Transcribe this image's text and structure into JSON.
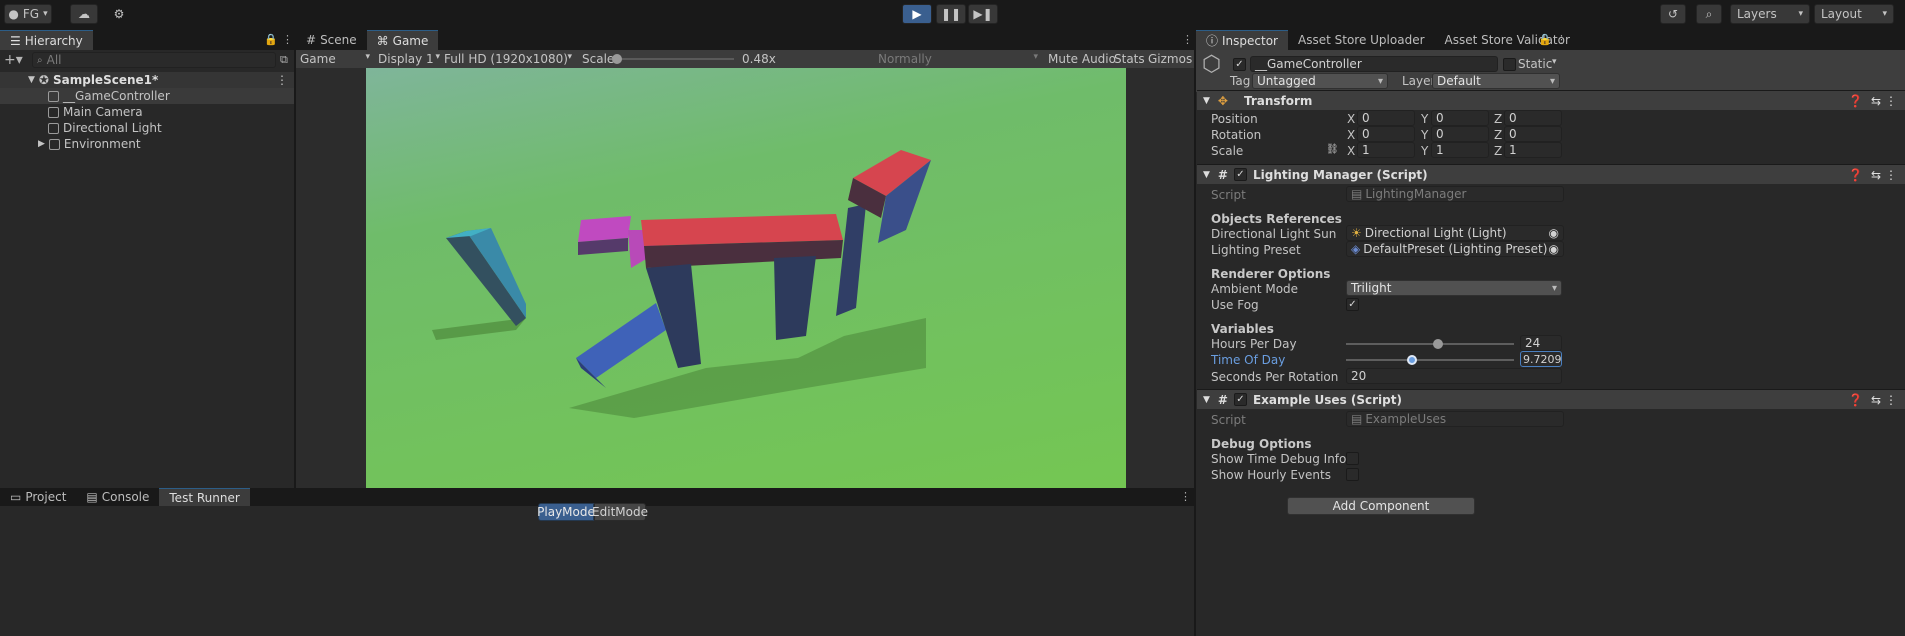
{
  "toolbar": {
    "account": "FG",
    "layers": "Layers",
    "layout": "Layout"
  },
  "hierarchy": {
    "tab": "Hierarchy",
    "search_placeholder": "All",
    "scene": "SampleScene1*",
    "items": [
      "__GameController",
      "Main Camera",
      "Directional Light",
      "Environment"
    ]
  },
  "center": {
    "tabs": [
      "Scene",
      "Game"
    ],
    "display_mode": "Game",
    "display": "Display 1",
    "resolution": "Full HD (1920x1080)",
    "scale_label": "Scale",
    "scale_value": "0.48x",
    "play_focus": "Normally",
    "mute": "Mute Audio",
    "stats": "Stats",
    "gizmos": "Gizmos"
  },
  "bottom": {
    "tabs": [
      "Project",
      "Console",
      "Test Runner"
    ],
    "modes": [
      "PlayMode",
      "EditMode"
    ]
  },
  "inspector": {
    "tabs": [
      "Inspector",
      "Asset Store Uploader",
      "Asset Store Validator"
    ],
    "object_name": "__GameController",
    "static_label": "Static",
    "tag_label": "Tag",
    "tag_value": "Untagged",
    "layer_label": "Layer",
    "layer_value": "Default",
    "transform": {
      "title": "Transform",
      "rows": [
        {
          "label": "Position",
          "x": "0",
          "y": "0",
          "z": "0"
        },
        {
          "label": "Rotation",
          "x": "0",
          "y": "0",
          "z": "0"
        },
        {
          "label": "Scale",
          "x": "1",
          "y": "1",
          "z": "1"
        }
      ]
    },
    "lighting": {
      "title": "Lighting Manager (Script)",
      "script_label": "Script",
      "script_value": "LightingManager",
      "objects_refs": "Objects References",
      "sun_label": "Directional Light Sun",
      "sun_value": "Directional Light (Light)",
      "preset_label": "Lighting Preset",
      "preset_value": "DefaultPreset (Lighting Preset)",
      "renderer_options": "Renderer Options",
      "ambient_label": "Ambient Mode",
      "ambient_value": "Trilight",
      "fog_label": "Use Fog",
      "variables": "Variables",
      "hours_label": "Hours Per Day",
      "hours_value": "24",
      "hours_fraction": 0.55,
      "time_label": "Time Of Day",
      "time_value": "9.72091",
      "time_fraction": 0.405,
      "seconds_label": "Seconds Per Rotation",
      "seconds_value": "20"
    },
    "example": {
      "title": "Example Uses (Script)",
      "script_label": "Script",
      "script_value": "ExampleUses",
      "debug_options": "Debug Options",
      "debug_info": "Show Time Debug Info",
      "hourly": "Show Hourly Events"
    },
    "add_component": "Add Component"
  },
  "colors": {
    "accent": "#3a5f8f",
    "sky": "#7fb59a",
    "ground": "#6cc14a",
    "red": "#d6454f",
    "blue": "#3f62b8"
  }
}
